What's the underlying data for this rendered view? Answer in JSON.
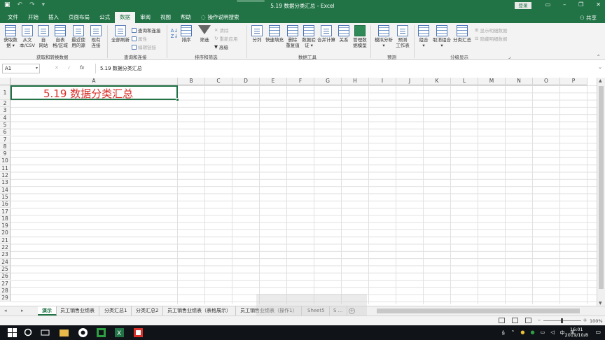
{
  "window": {
    "title": "5.19 数据分类汇总 - Excel",
    "login_label": "登录",
    "share_label": "共享"
  },
  "tabs": [
    "文件",
    "开始",
    "插入",
    "页面布局",
    "公式",
    "数据",
    "审阅",
    "视图",
    "帮助"
  ],
  "tell_me": "操作说明搜索",
  "ribbon": {
    "get_data": "获取数\n据",
    "from_csv": "从文\n本/CSV",
    "from_web": "自\n网站",
    "from_table": "自表\n格/区域",
    "recent_sources": "最近使\n用的源",
    "existing_conn": "现有\n连接",
    "refresh_all": "全部刷新",
    "queries_conn": "查询和连接",
    "properties": "属性",
    "edit_links": "编辑链接",
    "sort_az": "排序",
    "filter": "筛选",
    "clear": "清除",
    "reapply": "重新应用",
    "advanced": "高级",
    "text_to_col": "分列",
    "flash_fill": "快速填充",
    "remove_dup": "删除\n重复值",
    "data_valid": "数据验\n证",
    "consolidate": "合并计算",
    "relationships": "关系",
    "manage_model": "管理数\n据模型",
    "what_if": "模拟分析",
    "forecast_sheet": "预测\n工作表",
    "group": "组合",
    "ungroup": "取消组合",
    "subtotal": "分类汇总",
    "show_detail": "显示明细数据",
    "hide_detail": "隐藏明细数据",
    "groups": {
      "get_transform": "获取和转换数据",
      "queries": "查询和连接",
      "sort_filter": "排序和筛选",
      "data_tools": "数据工具",
      "forecast": "预测",
      "outline": "分级显示"
    }
  },
  "formula_bar": {
    "name_box": "A1",
    "fx": "fx",
    "content": "5.19 数据分类汇总"
  },
  "grid": {
    "columns": [
      "A",
      "B",
      "C",
      "D",
      "E",
      "F",
      "G",
      "H",
      "I",
      "J",
      "K",
      "L",
      "M",
      "N",
      "O",
      "P"
    ],
    "rows": [
      "1",
      "2",
      "3",
      "4",
      "5",
      "6",
      "7",
      "8",
      "9",
      "10",
      "11",
      "12",
      "13",
      "14",
      "15",
      "16",
      "17",
      "18",
      "19",
      "20",
      "21",
      "22",
      "23",
      "24",
      "25",
      "26",
      "27",
      "28",
      "29"
    ],
    "cell_a1": "5.19 数据分类汇总"
  },
  "sheets": [
    "演示",
    "员工销售业绩表",
    "分类汇总1",
    "分类汇总2",
    "员工销售业绩表（表格展示）",
    "员工销售业绩表（操作1）",
    "Sheet5",
    "S ..."
  ],
  "active_sheet": "演示",
  "status": {
    "zoom": "100%"
  },
  "taskbar": {
    "time": "16:01",
    "date": "2019/10/8",
    "ime": "中"
  },
  "colors": {
    "excel_green": "#217346",
    "title_red": "#d9302a"
  }
}
